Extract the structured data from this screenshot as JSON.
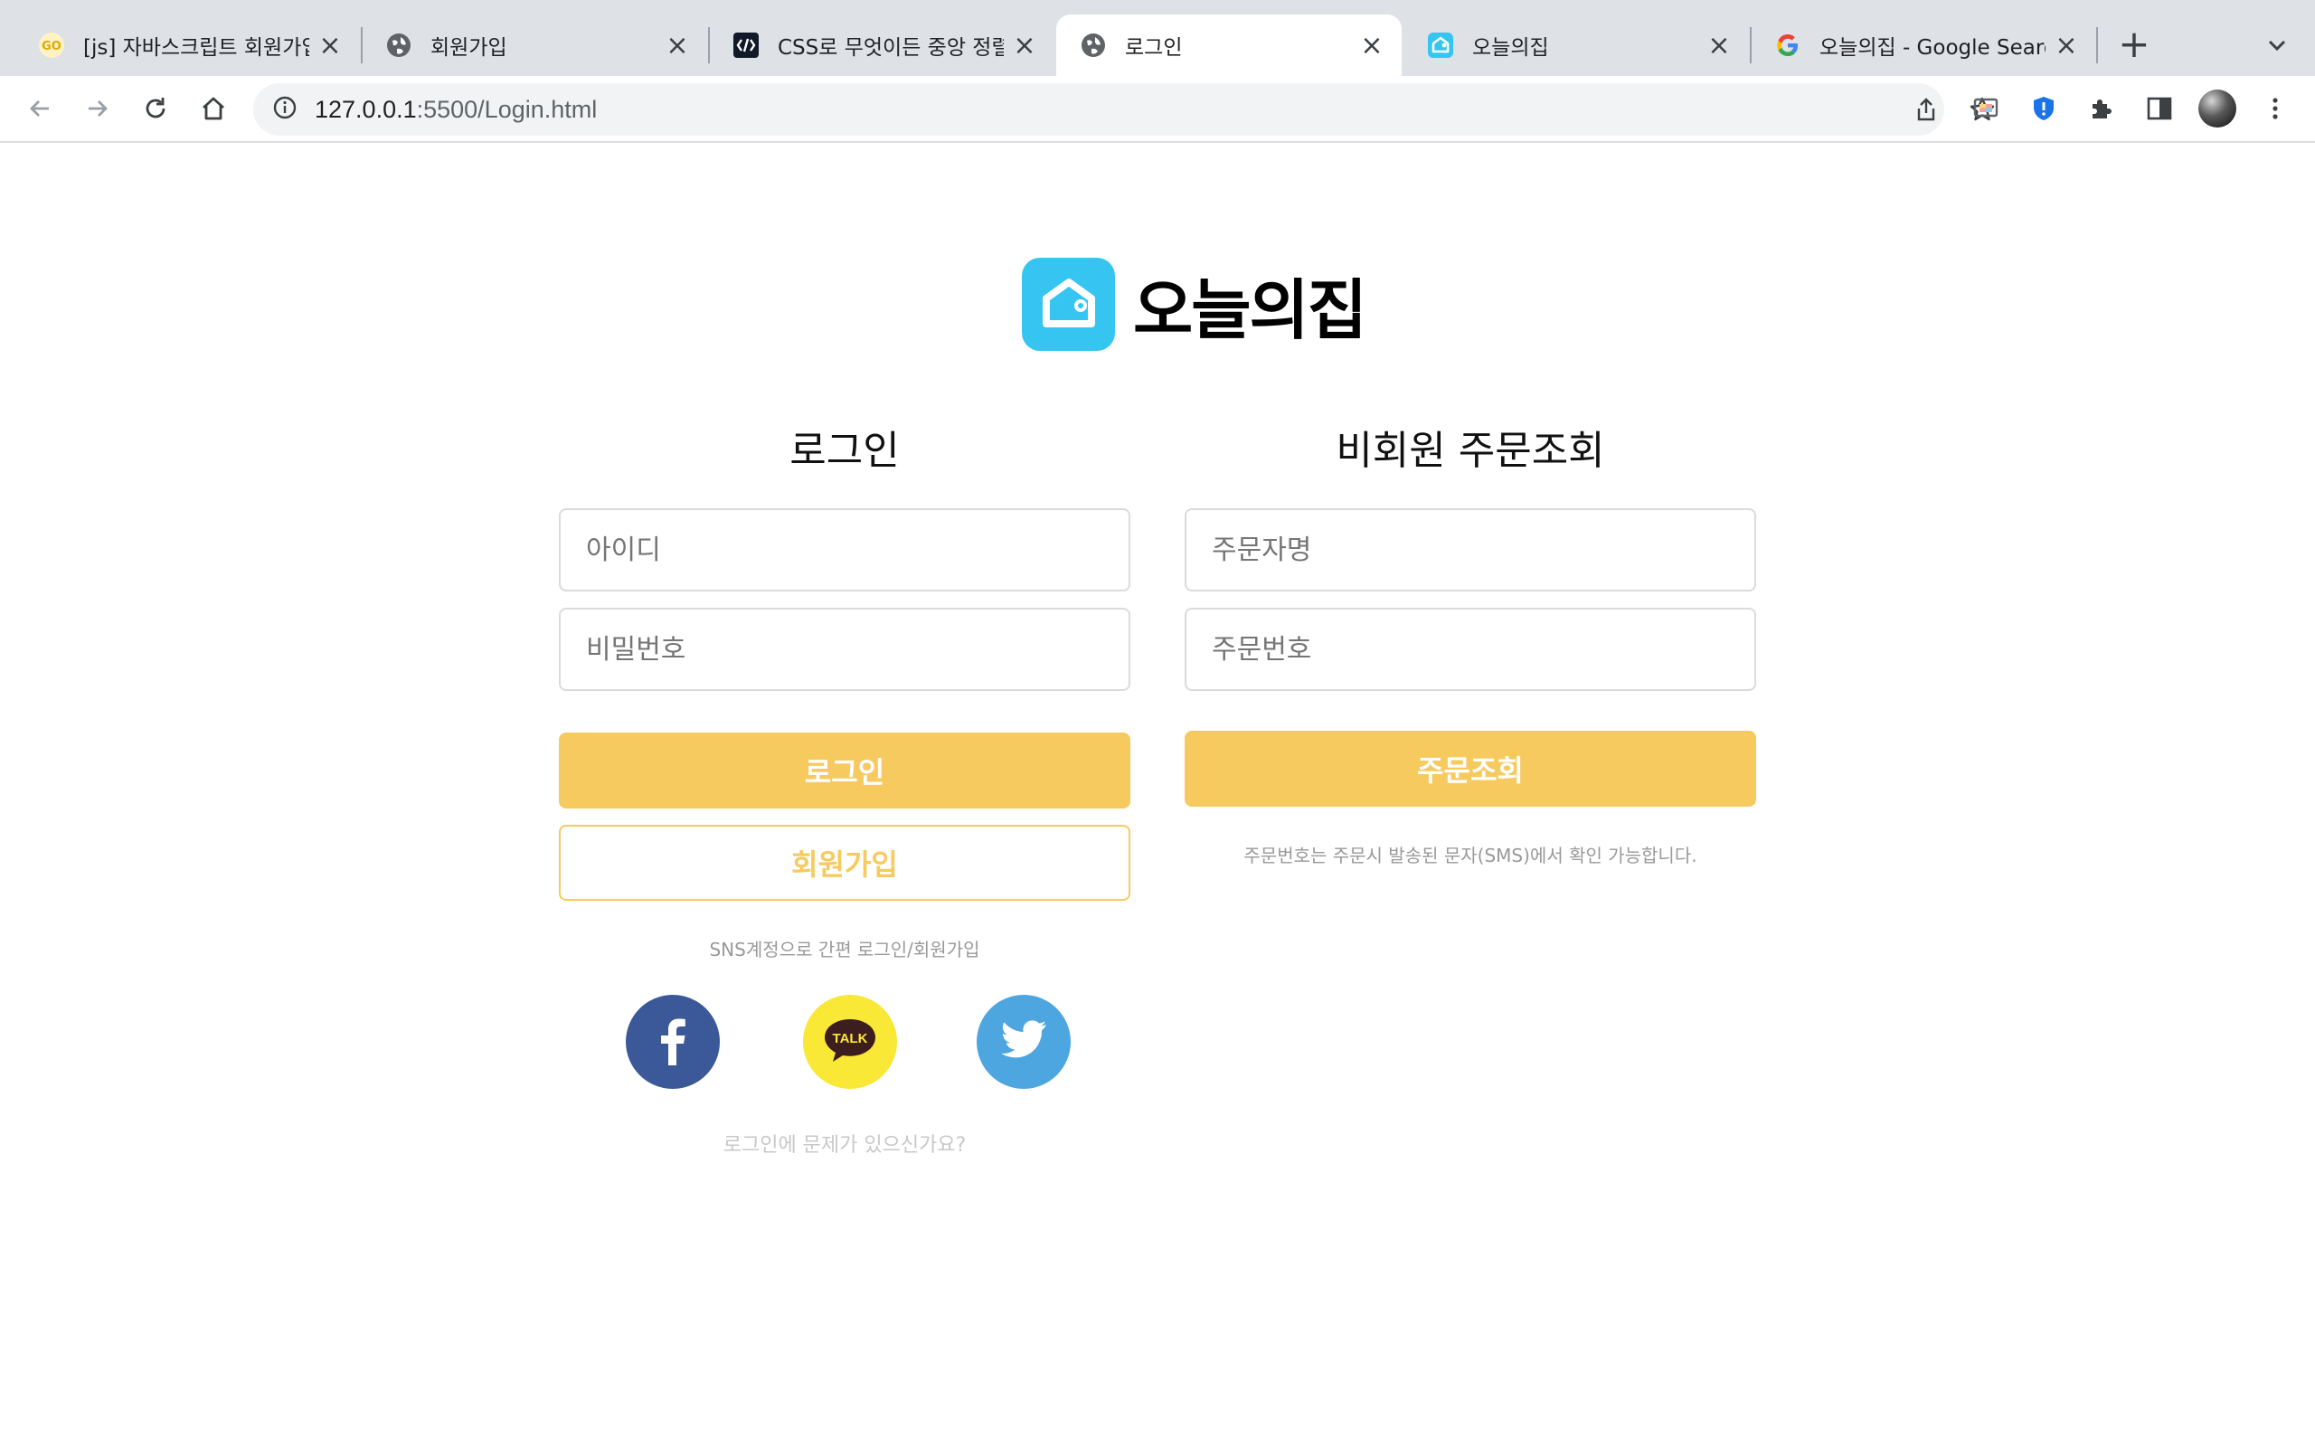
{
  "browser": {
    "tabs": [
      {
        "title": "[js] 자바스크립트 회원가입",
        "favicon": "go-icon"
      },
      {
        "title": "회원가입",
        "favicon": "globe-icon"
      },
      {
        "title": "CSS로 무엇이든 중앙 정렬",
        "favicon": "code-icon"
      },
      {
        "title": "로그인",
        "favicon": "globe-icon",
        "active": true
      },
      {
        "title": "오늘의집",
        "favicon": "ohouse-icon"
      },
      {
        "title": "오늘의집 - Google Search",
        "favicon": "google-icon"
      }
    ],
    "address": {
      "host": "127.0.0.1",
      "path": ":5500/Login.html"
    }
  },
  "brand": {
    "name": "오늘의집",
    "color": "#35c5f0"
  },
  "login": {
    "title": "로그인",
    "id_placeholder": "아이디",
    "password_placeholder": "비밀번호",
    "login_button": "로그인",
    "signup_button": "회원가입",
    "sns_text": "SNS계정으로 간편 로그인/회원가입",
    "sns": [
      {
        "name": "facebook",
        "color": "#3b5998",
        "glyph": "f"
      },
      {
        "name": "kakao",
        "color": "#f9e835",
        "glyph": "TALK"
      },
      {
        "name": "twitter",
        "color": "#4ea6e0",
        "glyph": ""
      }
    ],
    "help_link": "로그인에 문제가 있으신가요?"
  },
  "guest_order": {
    "title": "비회원 주문조회",
    "name_placeholder": "주문자명",
    "order_number_placeholder": "주문번호",
    "lookup_button": "주문조회",
    "note": "주문번호는 주문시 발송된 문자(SMS)에서 확인 가능합니다."
  },
  "colors": {
    "accent": "#f7ca5f",
    "border": "#dbdbdb"
  }
}
